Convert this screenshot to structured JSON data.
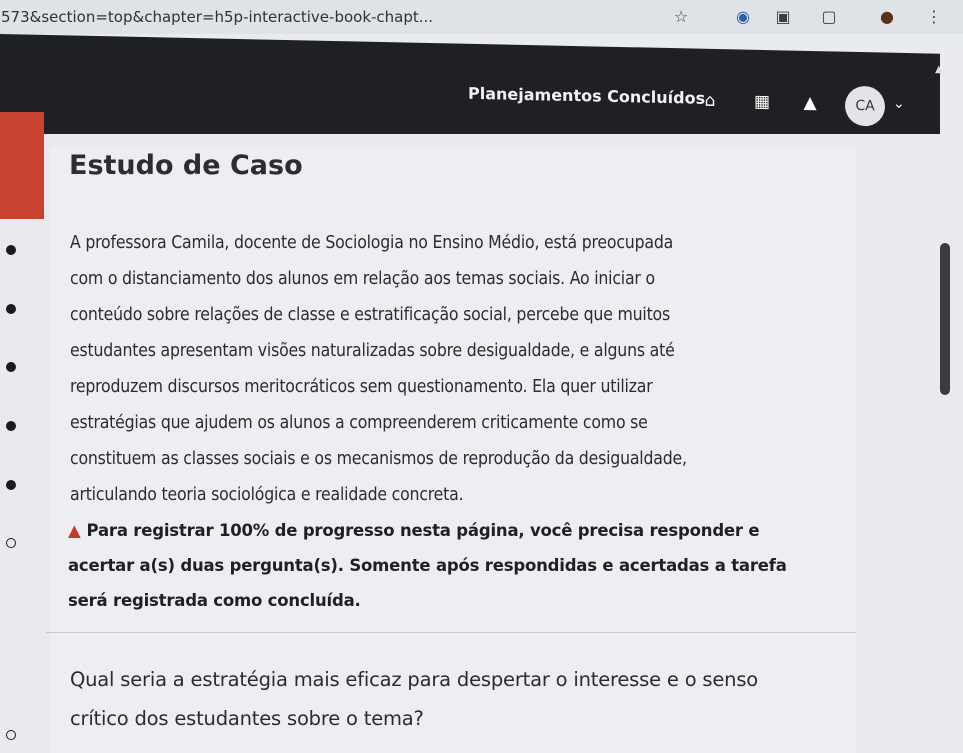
{
  "browser": {
    "url": "…573&section=top&chapter=h5p-interactive-book-chapt...",
    "icons": [
      "star-icon",
      "extension-icon",
      "puzzle-icon",
      "profile-icon",
      "menu-icon"
    ]
  },
  "header": {
    "title": "Planejamentos Concluídos",
    "avatar_initials": "CA"
  },
  "main": {
    "heading": "Estudo de Caso",
    "paragraph_lines": [
      "A professora Camila, docente de Sociologia no Ensino Médio, está preocupada",
      "com o distanciamento dos alunos em relação aos temas sociais. Ao iniciar o",
      "conteúdo sobre relações de classe e estratificação social, percebe que muitos",
      "estudantes apresentam visões naturalizadas sobre desigualdade, e alguns até",
      "reproduzem discursos meritocráticos sem questionamento. Ela quer utilizar",
      "estratégias que ajudem os alunos a compreenderem criticamente como se",
      "constituem as classes sociais e os mecanismos de reprodução da desigualdade,",
      "articulando teoria sociológica e realidade concreta."
    ],
    "notice_lines": [
      "Para registrar 100% de progresso nesta página, você precisa responder e",
      "acertar a(s) duas pergunta(s). Somente após respondidas e acertadas a tarefa",
      "será registrada como concluída."
    ],
    "question_lines": [
      "Qual seria a estratégia mais eficaz para despertar o interesse e o senso",
      "crítico dos estudantes sobre o tema?"
    ]
  },
  "colors": {
    "accent_red": "#c8432f",
    "header_bg": "#1f2023"
  }
}
